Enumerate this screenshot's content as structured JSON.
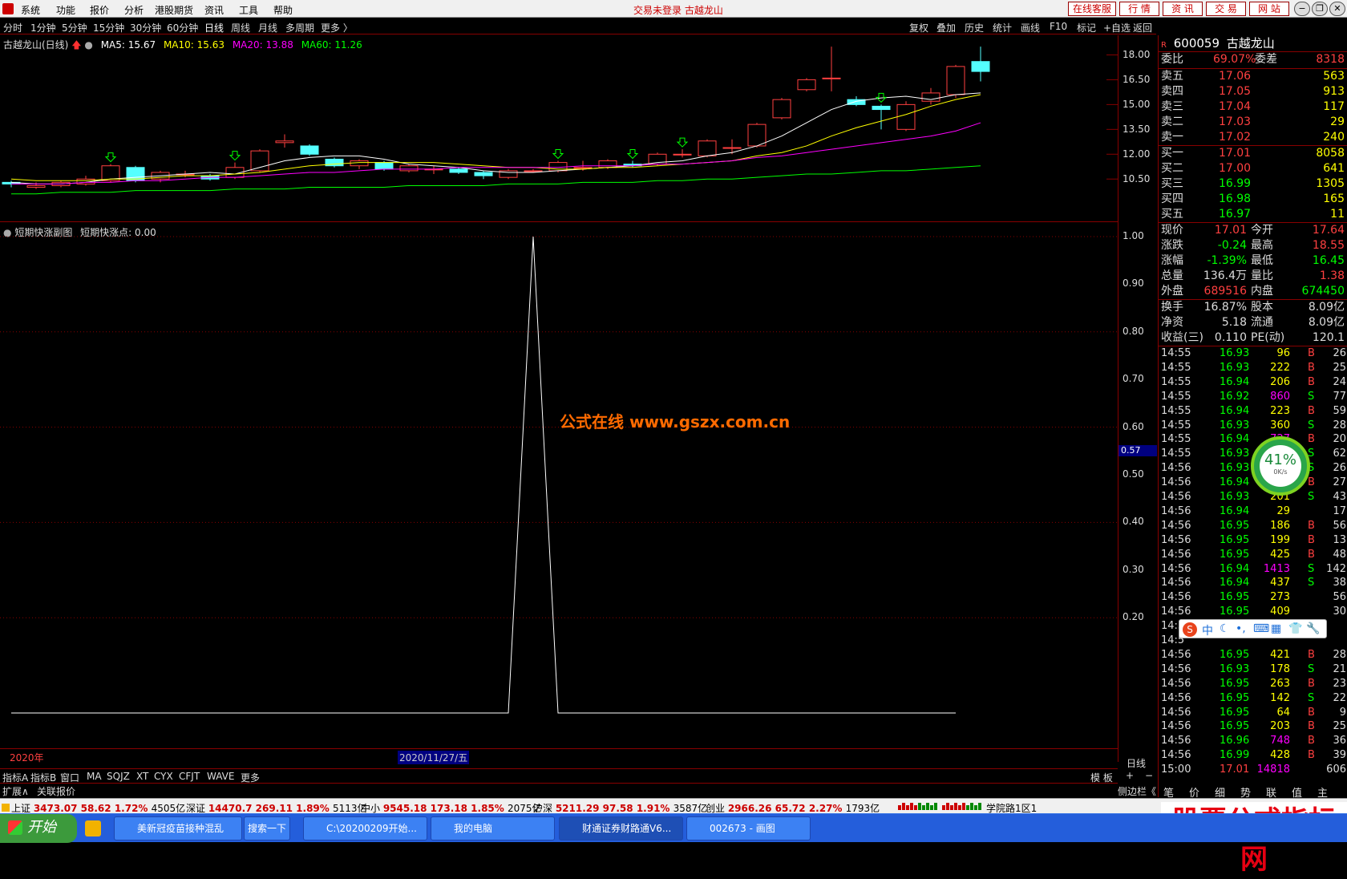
{
  "menu": {
    "items": [
      "系统",
      "功能",
      "报价",
      "分析",
      "港股期货",
      "资讯",
      "工具",
      "帮助"
    ],
    "center_title": "交易未登录  古越龙山",
    "buttons": [
      "在线客服",
      "行  情",
      "资  讯",
      "交  易",
      "网  站"
    ]
  },
  "periods": {
    "items": [
      "分时",
      "1分钟",
      "5分钟",
      "15分钟",
      "30分钟",
      "60分钟",
      "日线",
      "周线",
      "月线",
      "多周期",
      "更多 〉"
    ],
    "active": "日线",
    "tools": [
      "复权",
      "叠加",
      "历史",
      "统计",
      "画线",
      "F10",
      "标记",
      "+自选",
      "返回"
    ]
  },
  "main_chart": {
    "name": "古越龙山(日线)",
    "ma": [
      {
        "label": "MA5: 15.67",
        "color": "#ffffff"
      },
      {
        "label": "MA10: 15.63",
        "color": "#ffff00"
      },
      {
        "label": "MA20: 13.88",
        "color": "#ff00ff"
      },
      {
        "label": "MA60: 11.26",
        "color": "#00ff00"
      }
    ],
    "yticks": [
      "18.00",
      "16.50",
      "15.00",
      "13.50",
      "12.00",
      "10.50"
    ]
  },
  "sub_chart": {
    "name": "短期快涨副图",
    "value_label": "短期快涨点: 0.00",
    "yticks": [
      "1.00",
      "0.90",
      "0.80",
      "0.70",
      "0.60",
      "0.50",
      "0.40",
      "0.30",
      "0.20"
    ],
    "cursor_value": "0.57",
    "year_label": "2020年",
    "date_label": "2020/11/27/五",
    "period_label": "日线"
  },
  "chart_data": {
    "type": "line",
    "title": "短期快涨副图",
    "series": [
      {
        "name": "短期快涨点",
        "values": [
          0,
          0,
          0,
          0,
          0,
          0,
          0,
          0,
          0,
          0,
          0,
          0,
          0,
          0,
          0,
          0,
          0,
          0,
          0,
          0,
          0,
          1,
          0,
          0,
          0,
          0,
          0,
          0,
          0,
          0,
          0,
          0,
          0,
          0,
          0,
          0,
          0,
          0,
          0
        ]
      }
    ],
    "ylim": [
      0,
      1
    ]
  },
  "candles": [
    {
      "o": 10.3,
      "c": 10.2,
      "h": 10.4,
      "l": 10.0
    },
    {
      "o": 10.0,
      "c": 10.1,
      "h": 10.3,
      "l": 9.9
    },
    {
      "o": 10.1,
      "c": 10.3,
      "h": 10.4,
      "l": 10.0
    },
    {
      "o": 10.2,
      "c": 10.5,
      "h": 10.7,
      "l": 10.1
    },
    {
      "o": 10.4,
      "c": 11.3,
      "h": 11.4,
      "l": 10.3
    },
    {
      "o": 11.2,
      "c": 10.4,
      "h": 11.3,
      "l": 10.3
    },
    {
      "o": 10.5,
      "c": 10.9,
      "h": 11.0,
      "l": 10.3
    },
    {
      "o": 10.8,
      "c": 10.8,
      "h": 11.0,
      "l": 10.6
    },
    {
      "o": 10.7,
      "c": 10.5,
      "h": 10.8,
      "l": 10.4
    },
    {
      "o": 10.6,
      "c": 11.2,
      "h": 11.5,
      "l": 10.5
    },
    {
      "o": 11.0,
      "c": 12.2,
      "h": 12.3,
      "l": 10.9
    },
    {
      "o": 12.7,
      "c": 12.8,
      "h": 13.2,
      "l": 12.4
    },
    {
      "o": 12.5,
      "c": 12.0,
      "h": 12.6,
      "l": 11.9
    },
    {
      "o": 11.7,
      "c": 11.3,
      "h": 11.8,
      "l": 11.2
    },
    {
      "o": 11.3,
      "c": 11.6,
      "h": 11.7,
      "l": 11.1
    },
    {
      "o": 11.5,
      "c": 11.1,
      "h": 11.6,
      "l": 11.0
    },
    {
      "o": 11.0,
      "c": 11.3,
      "h": 11.4,
      "l": 10.9
    },
    {
      "o": 11.1,
      "c": 11.1,
      "h": 11.3,
      "l": 10.8
    },
    {
      "o": 11.1,
      "c": 10.9,
      "h": 11.2,
      "l": 10.8
    },
    {
      "o": 10.9,
      "c": 10.7,
      "h": 11.0,
      "l": 10.5
    },
    {
      "o": 10.6,
      "c": 11.0,
      "h": 11.1,
      "l": 10.5
    },
    {
      "o": 11.0,
      "c": 11.0,
      "h": 11.1,
      "l": 10.9
    },
    {
      "o": 11.0,
      "c": 11.5,
      "h": 11.6,
      "l": 10.9
    },
    {
      "o": 11.2,
      "c": 11.2,
      "h": 11.6,
      "l": 11.0
    },
    {
      "o": 11.2,
      "c": 11.6,
      "h": 11.7,
      "l": 11.1
    },
    {
      "o": 11.4,
      "c": 11.3,
      "h": 11.6,
      "l": 11.2
    },
    {
      "o": 11.4,
      "c": 12.0,
      "h": 12.1,
      "l": 11.3
    },
    {
      "o": 12.0,
      "c": 12.0,
      "h": 12.3,
      "l": 11.8
    },
    {
      "o": 11.9,
      "c": 12.8,
      "h": 12.9,
      "l": 11.8
    },
    {
      "o": 12.4,
      "c": 12.4,
      "h": 12.9,
      "l": 12.0
    },
    {
      "o": 12.5,
      "c": 13.8,
      "h": 13.9,
      "l": 12.4
    },
    {
      "o": 14.2,
      "c": 15.3,
      "h": 15.4,
      "l": 14.1
    },
    {
      "o": 15.9,
      "c": 16.5,
      "h": 16.6,
      "l": 15.8
    },
    {
      "o": 16.6,
      "c": 16.6,
      "h": 18.5,
      "l": 15.8
    },
    {
      "o": 15.3,
      "c": 15.0,
      "h": 15.5,
      "l": 14.9
    },
    {
      "o": 14.9,
      "c": 14.7,
      "h": 15.0,
      "l": 13.5
    },
    {
      "o": 13.5,
      "c": 15.0,
      "h": 15.2,
      "l": 13.4
    },
    {
      "o": 15.2,
      "c": 15.7,
      "h": 16.0,
      "l": 15.0
    },
    {
      "o": 15.6,
      "c": 17.3,
      "h": 17.4,
      "l": 15.4
    },
    {
      "o": 17.6,
      "c": 17.0,
      "h": 18.5,
      "l": 16.4
    }
  ],
  "ma_lines": {
    "ma5": [
      10.3,
      10.2,
      10.2,
      10.3,
      10.5,
      10.6,
      10.7,
      10.8,
      10.9,
      10.8,
      11.2,
      11.6,
      11.8,
      11.9,
      11.9,
      11.7,
      11.4,
      11.3,
      11.2,
      11.0,
      10.9,
      10.9,
      11.0,
      11.1,
      11.2,
      11.3,
      11.5,
      11.6,
      11.9,
      12.1,
      12.5,
      13.1,
      13.9,
      14.7,
      15.2,
      15.4,
      15.5,
      15.3,
      15.6,
      15.7
    ],
    "ma10": [
      10.5,
      10.4,
      10.4,
      10.4,
      10.5,
      10.5,
      10.6,
      10.7,
      10.7,
      10.8,
      10.9,
      11.1,
      11.3,
      11.4,
      11.5,
      11.5,
      11.5,
      11.5,
      11.4,
      11.3,
      11.2,
      11.2,
      11.1,
      11.1,
      11.2,
      11.2,
      11.3,
      11.4,
      11.5,
      11.6,
      11.9,
      12.1,
      12.5,
      13.1,
      13.6,
      14.0,
      14.4,
      14.9,
      15.3,
      15.6
    ],
    "ma20": [
      10.2,
      10.2,
      10.2,
      10.3,
      10.3,
      10.4,
      10.4,
      10.5,
      10.6,
      10.6,
      10.7,
      10.8,
      10.9,
      10.9,
      11.0,
      11.1,
      11.1,
      11.1,
      11.2,
      11.2,
      11.2,
      11.2,
      11.2,
      11.3,
      11.3,
      11.3,
      11.4,
      11.4,
      11.5,
      11.6,
      11.8,
      11.9,
      12.1,
      12.3,
      12.5,
      12.7,
      12.9,
      13.1,
      13.4,
      13.9
    ],
    "ma60": [
      9.6,
      9.6,
      9.7,
      9.7,
      9.7,
      9.8,
      9.8,
      9.8,
      9.8,
      9.9,
      9.9,
      9.9,
      10.0,
      10.0,
      10.0,
      10.0,
      10.1,
      10.1,
      10.1,
      10.1,
      10.2,
      10.2,
      10.2,
      10.3,
      10.3,
      10.3,
      10.4,
      10.4,
      10.5,
      10.5,
      10.6,
      10.7,
      10.8,
      10.8,
      10.9,
      11.0,
      11.0,
      11.1,
      11.2,
      11.3
    ]
  },
  "quote": {
    "code": "600059",
    "name": "古越龙山",
    "wei_bi_label": "委比",
    "wei_bi": "69.07%",
    "wei_cha_label": "委差",
    "wei_cha": "8318",
    "asks": [
      {
        "label": "卖五",
        "price": "17.06",
        "vol": "563"
      },
      {
        "label": "卖四",
        "price": "17.05",
        "vol": "913"
      },
      {
        "label": "卖三",
        "price": "17.04",
        "vol": "117"
      },
      {
        "label": "卖二",
        "price": "17.03",
        "vol": "29"
      },
      {
        "label": "卖一",
        "price": "17.02",
        "vol": "240"
      }
    ],
    "bids": [
      {
        "label": "买一",
        "price": "17.01",
        "vol": "8058"
      },
      {
        "label": "买二",
        "price": "17.00",
        "vol": "641"
      },
      {
        "label": "买三",
        "price": "16.99",
        "vol": "1305"
      },
      {
        "label": "买四",
        "price": "16.98",
        "vol": "165"
      },
      {
        "label": "买五",
        "price": "16.97",
        "vol": "11"
      }
    ],
    "stats": [
      {
        "l1": "现价",
        "v1": "17.01",
        "c1": "#ff4040",
        "l2": "今开",
        "v2": "17.64",
        "c2": "#ff4040"
      },
      {
        "l1": "涨跌",
        "v1": "-0.24",
        "c1": "#00ff00",
        "l2": "最高",
        "v2": "18.55",
        "c2": "#ff4040"
      },
      {
        "l1": "涨幅",
        "v1": "-1.39%",
        "c1": "#00ff00",
        "l2": "最低",
        "v2": "16.45",
        "c2": "#00ff00"
      },
      {
        "l1": "总量",
        "v1": "136.4万",
        "c1": "#dddddd",
        "l2": "量比",
        "v2": "1.38",
        "c2": "#ff4040"
      },
      {
        "l1": "外盘",
        "v1": "689516",
        "c1": "#ff4040",
        "l2": "内盘",
        "v2": "674450",
        "c2": "#00ff00"
      }
    ],
    "stats2": [
      {
        "l1": "换手",
        "v1": "16.87%",
        "l2": "股本",
        "v2": "8.09亿"
      },
      {
        "l1": "净资",
        "v1": "5.18",
        "l2": "流通",
        "v2": "8.09亿"
      },
      {
        "l1": "收益(三)",
        "v1": "0.110",
        "l2": "PE(动)",
        "v2": "120.1"
      }
    ]
  },
  "ticks": [
    {
      "t": "14:55",
      "p": "16.93",
      "pc": "#00ff00",
      "v": "96",
      "vc": "#ffff00",
      "d": "B",
      "n": "26"
    },
    {
      "t": "14:55",
      "p": "16.93",
      "pc": "#00ff00",
      "v": "222",
      "vc": "#ffff00",
      "d": "B",
      "n": "25"
    },
    {
      "t": "14:55",
      "p": "16.94",
      "pc": "#00ff00",
      "v": "206",
      "vc": "#ffff00",
      "d": "B",
      "n": "24"
    },
    {
      "t": "14:55",
      "p": "16.92",
      "pc": "#00ff00",
      "v": "860",
      "vc": "#ff00ff",
      "d": "S",
      "n": "77"
    },
    {
      "t": "14:55",
      "p": "16.94",
      "pc": "#00ff00",
      "v": "223",
      "vc": "#ffff00",
      "d": "B",
      "n": "59"
    },
    {
      "t": "14:55",
      "p": "16.93",
      "pc": "#00ff00",
      "v": "360",
      "vc": "#ffff00",
      "d": "S",
      "n": "28"
    },
    {
      "t": "14:55",
      "p": "16.94",
      "pc": "#00ff00",
      "v": "727",
      "vc": "#ff00ff",
      "d": "B",
      "n": "20"
    },
    {
      "t": "14:55",
      "p": "16.93",
      "pc": "#00ff00",
      "v": "",
      "vc": "#ffff00",
      "d": "S",
      "n": "62"
    },
    {
      "t": "14:56",
      "p": "16.93",
      "pc": "#00ff00",
      "v": "",
      "vc": "#ffff00",
      "d": "S",
      "n": "26"
    },
    {
      "t": "14:56",
      "p": "16.94",
      "pc": "#00ff00",
      "v": "",
      "vc": "#ffff00",
      "d": "B",
      "n": "27"
    },
    {
      "t": "14:56",
      "p": "16.93",
      "pc": "#00ff00",
      "v": "201",
      "vc": "#ffff00",
      "d": "S",
      "n": "43"
    },
    {
      "t": "14:56",
      "p": "16.94",
      "pc": "#00ff00",
      "v": "29",
      "vc": "#ffff00",
      "d": "",
      "n": "17"
    },
    {
      "t": "14:56",
      "p": "16.95",
      "pc": "#00ff00",
      "v": "186",
      "vc": "#ffff00",
      "d": "B",
      "n": "56"
    },
    {
      "t": "14:56",
      "p": "16.95",
      "pc": "#00ff00",
      "v": "199",
      "vc": "#ffff00",
      "d": "B",
      "n": "13"
    },
    {
      "t": "14:56",
      "p": "16.95",
      "pc": "#00ff00",
      "v": "425",
      "vc": "#ffff00",
      "d": "B",
      "n": "48"
    },
    {
      "t": "14:56",
      "p": "16.94",
      "pc": "#00ff00",
      "v": "1413",
      "vc": "#ff00ff",
      "d": "S",
      "n": "142"
    },
    {
      "t": "14:56",
      "p": "16.94",
      "pc": "#00ff00",
      "v": "437",
      "vc": "#ffff00",
      "d": "S",
      "n": "38"
    },
    {
      "t": "14:56",
      "p": "16.95",
      "pc": "#00ff00",
      "v": "273",
      "vc": "#ffff00",
      "d": "",
      "n": "56"
    },
    {
      "t": "14:56",
      "p": "16.95",
      "pc": "#00ff00",
      "v": "409",
      "vc": "#ffff00",
      "d": "",
      "n": "30"
    },
    {
      "t": "14:56",
      "p": "",
      "pc": "#00ff00",
      "v": "",
      "vc": "#ffff00",
      "d": "",
      "n": ""
    },
    {
      "t": "14:5",
      "p": "",
      "pc": "#00ff00",
      "v": "",
      "vc": "#ffff00",
      "d": "",
      "n": ""
    },
    {
      "t": "14:56",
      "p": "16.95",
      "pc": "#00ff00",
      "v": "421",
      "vc": "#ffff00",
      "d": "B",
      "n": "28"
    },
    {
      "t": "14:56",
      "p": "16.93",
      "pc": "#00ff00",
      "v": "178",
      "vc": "#ffff00",
      "d": "S",
      "n": "21"
    },
    {
      "t": "14:56",
      "p": "16.95",
      "pc": "#00ff00",
      "v": "263",
      "vc": "#ffff00",
      "d": "B",
      "n": "23"
    },
    {
      "t": "14:56",
      "p": "16.95",
      "pc": "#00ff00",
      "v": "142",
      "vc": "#ffff00",
      "d": "S",
      "n": "22"
    },
    {
      "t": "14:56",
      "p": "16.95",
      "pc": "#00ff00",
      "v": "64",
      "vc": "#ffff00",
      "d": "B",
      "n": "9"
    },
    {
      "t": "14:56",
      "p": "16.95",
      "pc": "#00ff00",
      "v": "203",
      "vc": "#ffff00",
      "d": "B",
      "n": "25"
    },
    {
      "t": "14:56",
      "p": "16.96",
      "pc": "#00ff00",
      "v": "748",
      "vc": "#ff00ff",
      "d": "B",
      "n": "36"
    },
    {
      "t": "14:56",
      "p": "16.99",
      "pc": "#00ff00",
      "v": "428",
      "vc": "#ffff00",
      "d": "B",
      "n": "39"
    },
    {
      "t": "15:00",
      "p": "17.01",
      "pc": "#ff4040",
      "v": "14818",
      "vc": "#ff00ff",
      "d": "",
      "n": "606"
    }
  ],
  "bottom_tabs": [
    "指标A",
    "指标B",
    "窗口",
    "MA",
    "SQJZ",
    "XT",
    "CYX",
    "CFJT",
    "WAVE",
    "更多"
  ],
  "bottom_right": [
    "模 板",
    "+",
    "−"
  ],
  "ext_tabs": [
    "扩展∧",
    "关联报价"
  ],
  "side_tabs": "侧边栏《",
  "side_tabs2": [
    "笔",
    "价",
    "细",
    "势",
    "联",
    "值",
    "主"
  ],
  "status": [
    {
      "name": "上证",
      "v": "3473.07",
      "c": "58.62",
      "p": "1.72%",
      "a": "4505亿"
    },
    {
      "name": "深证",
      "v": "14470.7",
      "c": "269.11",
      "p": "1.89%",
      "a": "5113亿"
    },
    {
      "name": "中小",
      "v": "9545.18",
      "c": "173.18",
      "p": "1.85%",
      "a": "2075亿"
    },
    {
      "name": "沪深",
      "v": "5211.29",
      "c": "97.58",
      "p": "1.91%",
      "a": "3587亿"
    },
    {
      "name": "创业",
      "v": "2966.26",
      "c": "65.72",
      "p": "2.27%",
      "a": "1793亿"
    }
  ],
  "status_loc": "学院路1区1",
  "watermark": "公式在线  www.gszx.com.cn",
  "brand": "股票公式指标网",
  "gauge": {
    "percent": "41%",
    "speed": "0K/s"
  },
  "ime": "中",
  "taskbar": {
    "start": "开始",
    "tasks": [
      "美新冠疫苗接种混乱",
      "搜索一下",
      "C:\\20200209开始...",
      "我的电脑",
      "财通证券财路通V6...",
      "002673 - 画图"
    ]
  },
  "colors": {
    "up": "#ff4040",
    "down": "#54ffff",
    "grid": "#800000"
  }
}
